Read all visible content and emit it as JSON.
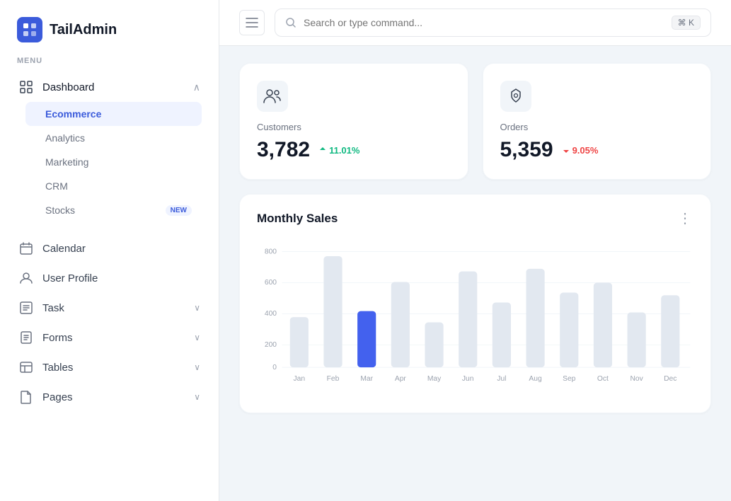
{
  "app": {
    "name": "TailAdmin"
  },
  "header": {
    "search_placeholder": "Search or type command...",
    "kbd": "⌘ K"
  },
  "sidebar": {
    "menu_label": "MENU",
    "dashboard": {
      "label": "Dashboard",
      "sub_items": [
        {
          "id": "ecommerce",
          "label": "Ecommerce",
          "active": true
        },
        {
          "id": "analytics",
          "label": "Analytics",
          "active": false
        },
        {
          "id": "marketing",
          "label": "Marketing",
          "active": false
        },
        {
          "id": "crm",
          "label": "CRM",
          "active": false
        },
        {
          "id": "stocks",
          "label": "Stocks",
          "badge": "NEW"
        }
      ]
    },
    "nav_items": [
      {
        "id": "calendar",
        "label": "Calendar",
        "icon": "calendar"
      },
      {
        "id": "user-profile",
        "label": "User Profile",
        "icon": "user"
      },
      {
        "id": "task",
        "label": "Task",
        "icon": "task",
        "has_arrow": true
      },
      {
        "id": "forms",
        "label": "Forms",
        "icon": "forms",
        "has_arrow": true
      },
      {
        "id": "tables",
        "label": "Tables",
        "icon": "tables",
        "has_arrow": true
      },
      {
        "id": "pages",
        "label": "Pages",
        "icon": "pages",
        "has_arrow": true
      }
    ]
  },
  "stats": [
    {
      "id": "customers",
      "label": "Customers",
      "value": "3,782",
      "trend": "+",
      "trend_value": "11.01%",
      "trend_dir": "up"
    },
    {
      "id": "orders",
      "label": "Orders",
      "value": "5,359",
      "trend": "↓",
      "trend_value": "9.05%",
      "trend_dir": "down"
    }
  ],
  "chart": {
    "title": "Monthly Sales",
    "months": [
      "Jan",
      "Feb",
      "Mar",
      "Apr",
      "May",
      "Jun",
      "Jul",
      "Aug",
      "Sep",
      "Oct",
      "Nov",
      "Dec"
    ],
    "values": [
      350,
      720,
      390,
      560,
      310,
      660,
      450,
      680,
      520,
      590,
      380,
      500
    ],
    "highlight_month": "Mar",
    "y_labels": [
      "0",
      "200",
      "400",
      "600",
      "800"
    ],
    "accent_color": "#4361ee",
    "default_color": "#e2e8f0"
  }
}
